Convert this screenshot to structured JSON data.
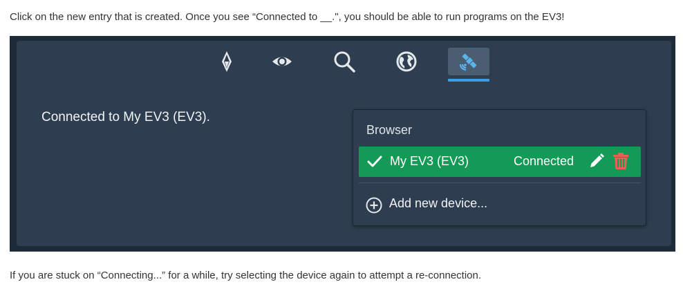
{
  "instructions": {
    "intro": "Click on the new entry that is created. Once you see “Connected to __.\", you should be able to run programs on the EV3!",
    "outro": "If you are stuck on “Connecting...” for a while, try selecting the device again to attempt a re-connection."
  },
  "toolbar": {
    "icons": [
      "compass-icon",
      "eye-icon",
      "search-icon",
      "globe-icon",
      "satellite-icon"
    ],
    "active_index": 4,
    "active_color": "#3aa0e6"
  },
  "status": {
    "text": "Connected to My EV3 (EV3)."
  },
  "browser": {
    "header": "Browser",
    "device": {
      "name": "My EV3 (EV3)",
      "status": "Connected",
      "row_color": "#139a56",
      "delete_color": "#e8604f"
    },
    "add_label": "Add new device..."
  }
}
